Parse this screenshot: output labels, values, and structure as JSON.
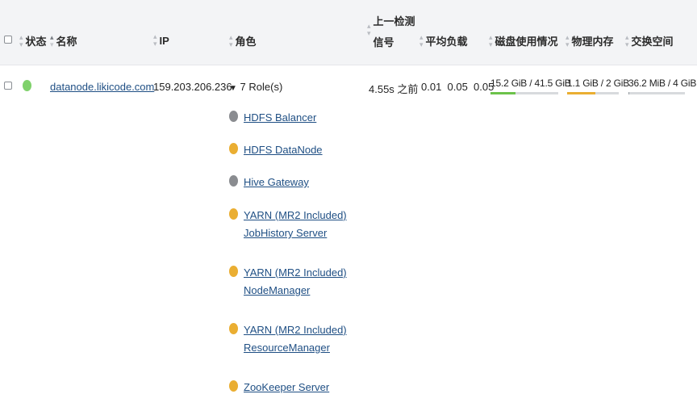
{
  "header": {
    "status": "状态",
    "name": "名称",
    "ip": "IP",
    "role": "角色",
    "last_heartbeat_line1": "上一检测",
    "last_heartbeat_line2": "信号",
    "load_avg": "平均负载",
    "disk_usage": "磁盘使用情况",
    "physical_memory": "物理内存",
    "swap_space": "交换空间"
  },
  "host": {
    "name": "datanode.likicode.com",
    "ip": "159.203.206.236",
    "status_color": "#7fd16b",
    "roles_toggle": "7 Role(s)",
    "last_heartbeat": "4.55s 之前",
    "load_avg": "0.01  0.05  0.05",
    "disk": {
      "text": "15.2 GiB / 41.5 GiB",
      "fraction": 0.366,
      "color": "#6cc24a"
    },
    "memory": {
      "text": "1.1 GiB / 2 GiB",
      "fraction": 0.55,
      "color": "#eaae32"
    },
    "swap": {
      "text": "36.2 MiB / 4 GiB",
      "fraction": 0.009,
      "color": "#9aa0a6"
    }
  },
  "roles": [
    {
      "line1": "HDFS Balancer",
      "line2": "",
      "status": "gray"
    },
    {
      "line1": "HDFS DataNode",
      "line2": "",
      "status": "orange"
    },
    {
      "line1": "Hive Gateway",
      "line2": "",
      "status": "gray"
    },
    {
      "line1": "YARN (MR2 Included)",
      "line2": "JobHistory Server",
      "status": "orange"
    },
    {
      "line1": "YARN (MR2 Included)",
      "line2": "NodeManager",
      "status": "orange"
    },
    {
      "line1": "YARN (MR2 Included)",
      "line2": "ResourceManager",
      "status": "orange"
    },
    {
      "line1": "ZooKeeper Server",
      "line2": "",
      "status": "orange"
    }
  ],
  "colors": {
    "link": "#1f4f84",
    "header_bg": "#f3f4f6",
    "gray": "#8a8c90",
    "orange": "#eaae32",
    "green": "#7fd16b"
  }
}
